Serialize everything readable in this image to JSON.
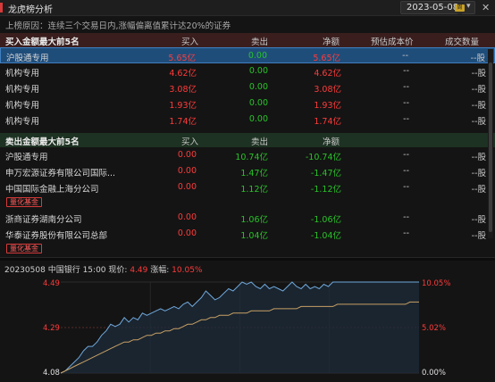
{
  "window": {
    "title": "龙虎榜分析",
    "date": "2023-05-08",
    "date_badge": "周一"
  },
  "reason": "上榜原因：连续三个交易日内,涨幅偏离值累计达20%的证券",
  "buy": {
    "title": "买入金额最大前5名",
    "columns": [
      "买入",
      "卖出",
      "净额",
      "预估成本价",
      "成交数量"
    ],
    "rows": [
      {
        "name": "沪股通专用",
        "buy": "5.65亿",
        "sell": "0.00",
        "net": "5.65亿",
        "cost": "--",
        "qty": "--股"
      },
      {
        "name": "机构专用",
        "buy": "4.62亿",
        "sell": "0.00",
        "net": "4.62亿",
        "cost": "--",
        "qty": "--股"
      },
      {
        "name": "机构专用",
        "buy": "3.08亿",
        "sell": "0.00",
        "net": "3.08亿",
        "cost": "--",
        "qty": "--股"
      },
      {
        "name": "机构专用",
        "buy": "1.93亿",
        "sell": "0.00",
        "net": "1.93亿",
        "cost": "--",
        "qty": "--股"
      },
      {
        "name": "机构专用",
        "buy": "1.74亿",
        "sell": "0.00",
        "net": "1.74亿",
        "cost": "--",
        "qty": "--股"
      }
    ]
  },
  "sell": {
    "title": "卖出金额最大前5名",
    "columns": [
      "买入",
      "卖出",
      "净额"
    ],
    "rows": [
      {
        "name": "沪股通专用",
        "buy": "0.00",
        "sell": "10.74亿",
        "net": "-10.74亿",
        "cost": "--",
        "qty": "--股"
      },
      {
        "name": "申万宏源证券有限公司国际...",
        "buy": "0.00",
        "sell": "1.47亿",
        "net": "-1.47亿",
        "cost": "--",
        "qty": "--股"
      },
      {
        "name": "中国国际金融上海分公司",
        "buy": "0.00",
        "sell": "1.12亿",
        "net": "-1.12亿",
        "cost": "--",
        "qty": "--股",
        "tag": "量化基金"
      },
      {
        "name": "浙商证券湖南分公司",
        "buy": "0.00",
        "sell": "1.06亿",
        "net": "-1.06亿",
        "cost": "--",
        "qty": "--股"
      },
      {
        "name": "华泰证券股份有限公司总部",
        "buy": "0.00",
        "sell": "1.04亿",
        "net": "-1.04亿",
        "cost": "--",
        "qty": "--股",
        "tag": "量化基金"
      }
    ]
  },
  "chart": {
    "date_label": "20230508",
    "stock": "中国银行",
    "time": "15:00",
    "price_label": "现价:",
    "price": "4.49",
    "change_label": "涨幅:",
    "change": "10.05%",
    "y_left": [
      "4.49",
      "4.29",
      "4.08"
    ],
    "y_right": [
      "10.05%",
      "5.02%",
      "0.00%"
    ]
  },
  "chart_data": {
    "type": "line",
    "ylim": [
      4.08,
      4.49
    ],
    "grid": true,
    "series": [
      {
        "color": "#6fa8dc",
        "values": [
          4.08,
          4.09,
          4.11,
          4.13,
          4.15,
          4.18,
          4.2,
          4.2,
          4.22,
          4.25,
          4.27,
          4.3,
          4.29,
          4.3,
          4.33,
          4.31,
          4.33,
          4.32,
          4.35,
          4.34,
          4.35,
          4.36,
          4.37,
          4.36,
          4.37,
          4.38,
          4.37,
          4.39,
          4.4,
          4.38,
          4.4,
          4.42,
          4.45,
          4.43,
          4.41,
          4.42,
          4.44,
          4.46,
          4.45,
          4.47,
          4.49,
          4.48,
          4.49,
          4.47,
          4.46,
          4.48,
          4.46,
          4.47,
          4.46,
          4.45,
          4.47,
          4.49,
          4.47,
          4.46,
          4.48,
          4.46,
          4.47,
          4.46,
          4.48,
          4.47,
          4.49,
          4.49,
          4.49,
          4.49,
          4.49,
          4.49,
          4.49,
          4.49,
          4.49,
          4.49,
          4.49,
          4.49,
          4.49,
          4.49,
          4.49,
          4.49,
          4.49,
          4.49,
          4.49,
          4.49
        ]
      },
      {
        "color": "#c8a064",
        "values": [
          4.08,
          4.09,
          4.1,
          4.11,
          4.12,
          4.13,
          4.14,
          4.15,
          4.16,
          4.17,
          4.18,
          4.19,
          4.2,
          4.21,
          4.22,
          4.22,
          4.23,
          4.23,
          4.24,
          4.25,
          4.25,
          4.26,
          4.26,
          4.27,
          4.27,
          4.28,
          4.28,
          4.29,
          4.3,
          4.3,
          4.31,
          4.32,
          4.32,
          4.33,
          4.33,
          4.34,
          4.34,
          4.34,
          4.35,
          4.35,
          4.35,
          4.35,
          4.36,
          4.36,
          4.36,
          4.36,
          4.36,
          4.37,
          4.37,
          4.37,
          4.37,
          4.37,
          4.37,
          4.38,
          4.38,
          4.38,
          4.38,
          4.38,
          4.38,
          4.38,
          4.38,
          4.39,
          4.39,
          4.39,
          4.39,
          4.39,
          4.39,
          4.39,
          4.39,
          4.39,
          4.39,
          4.39,
          4.39,
          4.39,
          4.39,
          4.39,
          4.39,
          4.4,
          4.4,
          4.4
        ]
      }
    ]
  }
}
